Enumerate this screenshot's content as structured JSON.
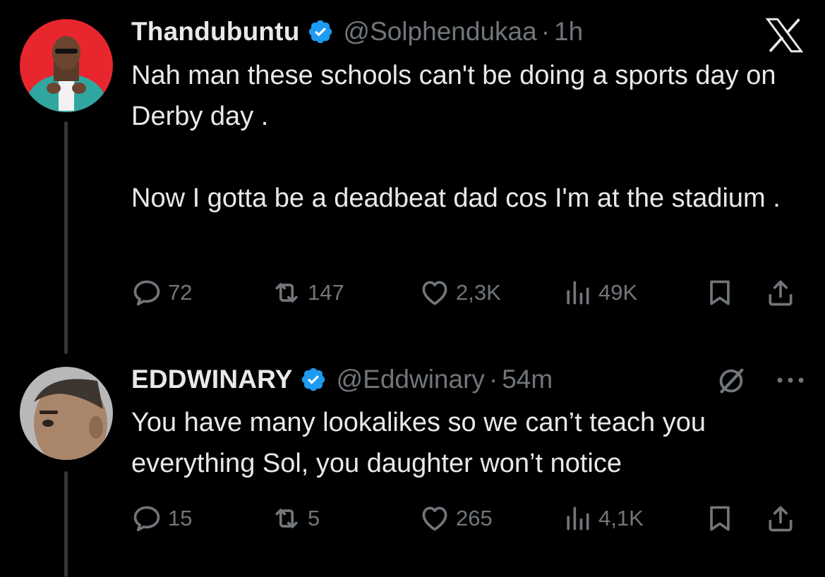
{
  "x_logo": "x-logo-icon",
  "tweets": [
    {
      "name": "Thandubuntu",
      "handle": "@Solphendukaa",
      "separator": "·",
      "time": "1h",
      "text": "Nah man these schools can't be doing a sports day on Derby day .\n\nNow I gotta be a deadbeat dad cos I'm at the stadium .",
      "replies": "72",
      "reposts": "147",
      "likes": "2,3K",
      "views": "49K"
    },
    {
      "name": "EDDWINARY",
      "handle": "@Eddwinary",
      "separator": "·",
      "time": "54m",
      "text": "You have many lookalikes so we can’t teach you everything Sol, you daughter won’t notice",
      "replies": "15",
      "reposts": "5",
      "likes": "265",
      "views": "4,1K"
    }
  ],
  "colors": {
    "background": "#000000",
    "text": "#e7e9ea",
    "secondary": "#71767b",
    "verified": "#1d9bf0",
    "thread_line": "#333639"
  }
}
